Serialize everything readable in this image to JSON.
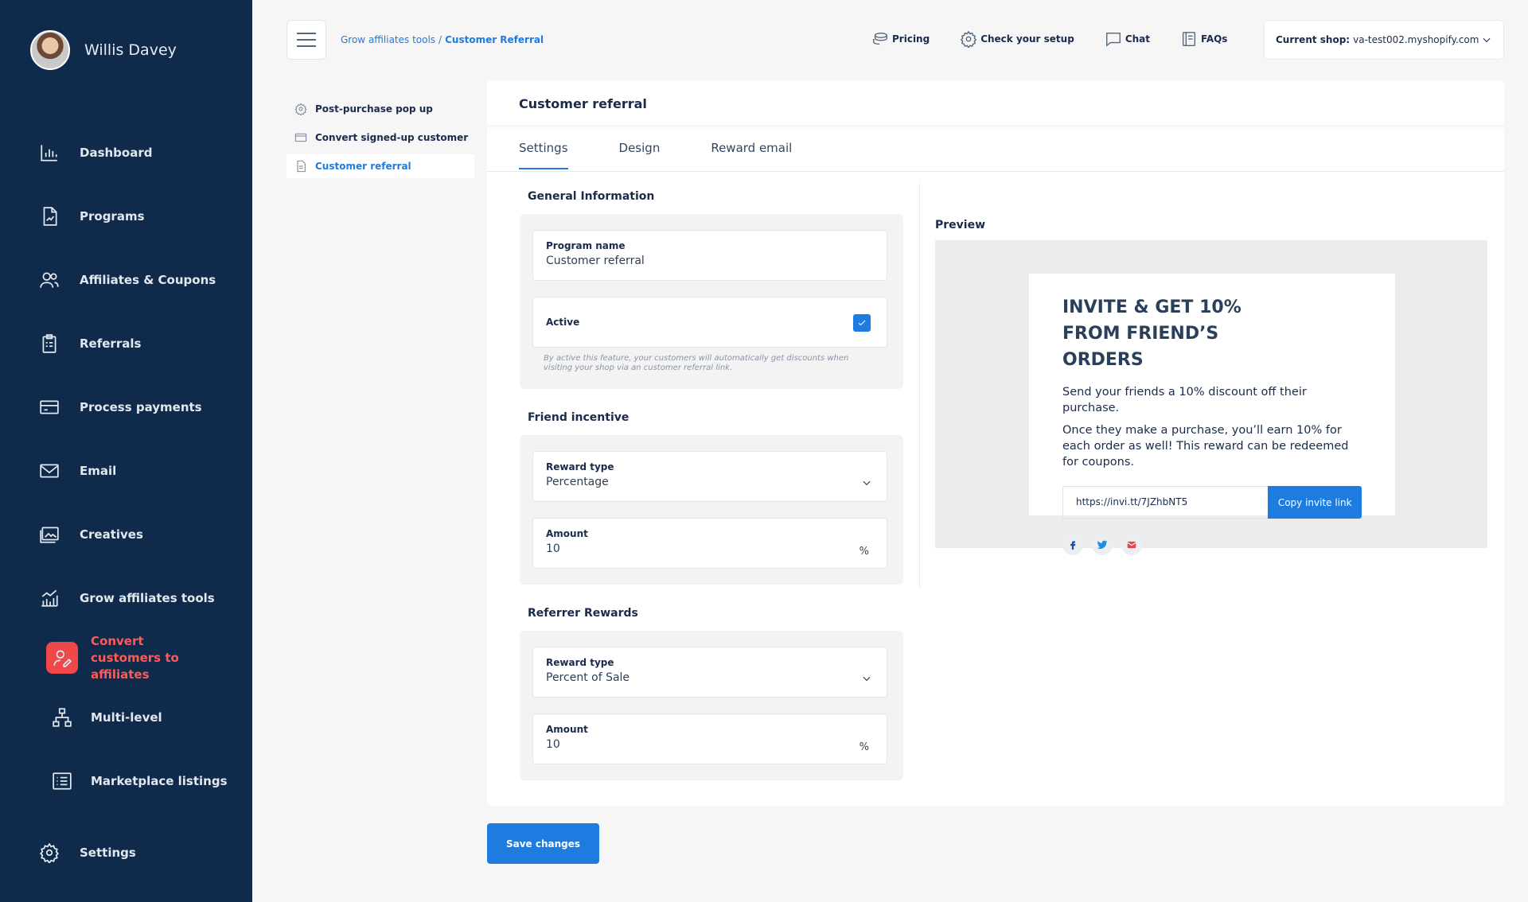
{
  "user": {
    "name": "Willis Davey"
  },
  "sidebar": {
    "items": [
      {
        "label": "Dashboard",
        "icon": "chart-bar-icon"
      },
      {
        "label": "Programs",
        "icon": "document-chart-icon"
      },
      {
        "label": "Affiliates & Coupons",
        "icon": "users-icon"
      },
      {
        "label": "Referrals",
        "icon": "clipboard-icon"
      },
      {
        "label": "Process payments",
        "icon": "credit-card-icon"
      },
      {
        "label": "Email",
        "icon": "envelope-icon"
      },
      {
        "label": "Creatives",
        "icon": "images-icon"
      },
      {
        "label": "Grow affiliates tools",
        "icon": "growth-chart-icon"
      },
      {
        "label": "Convert customers to affiliates",
        "icon": "user-edit-icon"
      },
      {
        "label": "Multi-level",
        "icon": "hierarchy-icon"
      },
      {
        "label": "Marketplace listings",
        "icon": "list-icon"
      },
      {
        "label": "Settings",
        "icon": "gear-icon"
      }
    ]
  },
  "breadcrumb": {
    "parent": "Grow affiliates tools",
    "separator": "/",
    "current": "Customer Referral"
  },
  "header": {
    "links": [
      {
        "label": "Pricing",
        "icon": "coins-icon"
      },
      {
        "label": "Check your setup",
        "icon": "gear-icon"
      },
      {
        "label": "Chat",
        "icon": "chat-icon"
      },
      {
        "label": "FAQs",
        "icon": "book-icon"
      }
    ],
    "shop_label": "Current shop:",
    "shop_value": "va-test002.myshopify.com"
  },
  "submenu": [
    {
      "label": "Post-purchase pop up",
      "icon": "gear-icon"
    },
    {
      "label": "Convert signed-up customer",
      "icon": "card-icon"
    },
    {
      "label": "Customer referral",
      "icon": "document-icon"
    }
  ],
  "card": {
    "title": "Customer referral",
    "tabs": [
      "Settings",
      "Design",
      "Reward email"
    ],
    "active_tab": "Settings"
  },
  "general": {
    "title": "General Information",
    "program_name_label": "Program name",
    "program_name_value": "Customer referral",
    "active_label": "Active",
    "active_checked": true,
    "hint": "By active this feature, your customers will automatically get discounts when visiting your shop via an customer referral link."
  },
  "friend": {
    "title": "Friend incentive",
    "reward_type_label": "Reward type",
    "reward_type_value": "Percentage",
    "amount_label": "Amount",
    "amount_value": "10",
    "amount_unit": "%"
  },
  "referrer": {
    "title": "Referrer Rewards",
    "reward_type_label": "Reward type",
    "reward_type_value": "Percent of Sale",
    "amount_label": "Amount",
    "amount_value": "10",
    "amount_unit": "%"
  },
  "preview": {
    "title": "Preview",
    "popup_title": "INVITE & GET 10% FROM FRIEND’S ORDERS",
    "text1": "Send your friends a 10% discount off their purchase.",
    "text2": "Once they make a purchase, you’ll earn 10% for each order as well! This reward can be redeemed for coupons.",
    "invite_link": "https://invi.tt/7JZhbNT5",
    "copy_label": "Copy invite link"
  },
  "save_label": "Save changes",
  "colors": {
    "sidebar": "#0f2a4a",
    "accent": "#1e7be0",
    "active_nav": "#f04848"
  }
}
